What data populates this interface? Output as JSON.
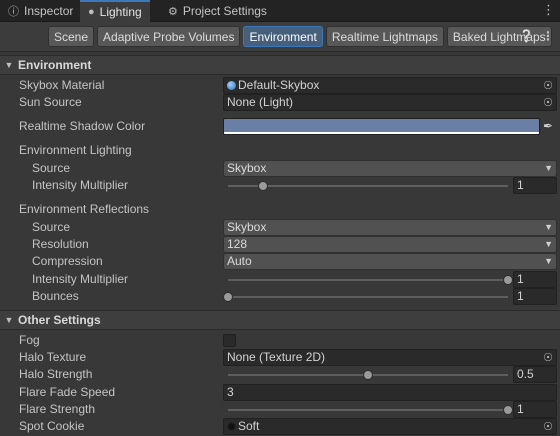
{
  "window_tabs": [
    {
      "label": "Inspector",
      "icon": "info-icon"
    },
    {
      "label": "Lighting",
      "icon": "lightbulb-icon",
      "active": true
    },
    {
      "label": "Project Settings",
      "icon": "gear-icon"
    }
  ],
  "toolbar": {
    "tabs": [
      "Scene",
      "Adaptive Probe Volumes",
      "Environment",
      "Realtime Lightmaps",
      "Baked Lightmaps"
    ],
    "active_tab": "Environment",
    "help_icon": "question-icon",
    "settings_icon": "settings-icon"
  },
  "environment": {
    "header": "Environment",
    "skybox_material": {
      "label": "Skybox Material",
      "value": "Default-Skybox"
    },
    "sun_source": {
      "label": "Sun Source",
      "value": "None (Light)"
    },
    "realtime_shadow_color": {
      "label": "Realtime Shadow Color",
      "color": "#6b7ea6"
    },
    "env_lighting": {
      "label": "Environment Lighting",
      "source": {
        "label": "Source",
        "value": "Skybox"
      },
      "intensity": {
        "label": "Intensity Multiplier",
        "value": "1",
        "fraction": 0.125
      }
    },
    "env_reflections": {
      "label": "Environment Reflections",
      "source": {
        "label": "Source",
        "value": "Skybox"
      },
      "resolution": {
        "label": "Resolution",
        "value": "128"
      },
      "compression": {
        "label": "Compression",
        "value": "Auto"
      },
      "intensity": {
        "label": "Intensity Multiplier",
        "value": "1",
        "fraction": 1.0
      },
      "bounces": {
        "label": "Bounces",
        "value": "1",
        "fraction": 0.0
      }
    }
  },
  "other_settings": {
    "header": "Other Settings",
    "fog": {
      "label": "Fog",
      "checked": false
    },
    "halo_texture": {
      "label": "Halo Texture",
      "value": "None (Texture 2D)"
    },
    "halo_strength": {
      "label": "Halo Strength",
      "value": "0.5",
      "fraction": 0.5
    },
    "flare_fade_speed": {
      "label": "Flare Fade Speed",
      "value": "3"
    },
    "flare_strength": {
      "label": "Flare Strength",
      "value": "1",
      "fraction": 1.0
    },
    "spot_cookie": {
      "label": "Spot Cookie",
      "value": "Soft"
    }
  },
  "colors": {
    "accent": "#3a79bb",
    "panel": "#383838",
    "field": "#2a2a2a"
  }
}
